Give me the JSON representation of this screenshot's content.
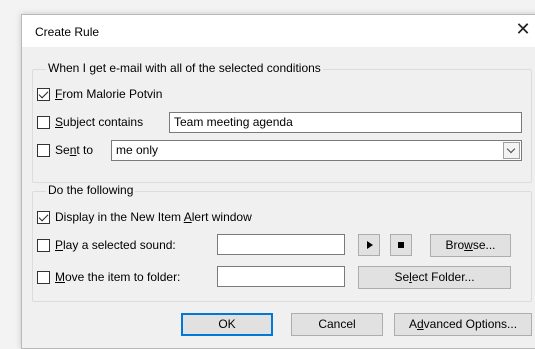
{
  "dialog": {
    "title": "Create Rule",
    "close_glyph": "✕"
  },
  "conditions": {
    "group_label": "When I get e-mail with all of the selected conditions",
    "from": {
      "checked": true,
      "label_u": "F",
      "label_rest": "rom Malorie Potvin"
    },
    "subject": {
      "checked": false,
      "label_u": "S",
      "label_rest": "ubject contains",
      "value": "Team meeting agenda"
    },
    "sent_to": {
      "checked": false,
      "label_pre": "Se",
      "label_u": "n",
      "label_rest": "t to",
      "value": "me only"
    }
  },
  "actions": {
    "group_label": "Do the following",
    "alert": {
      "checked": true,
      "label_pre": "Display in the New Item ",
      "label_u": "A",
      "label_rest": "lert window"
    },
    "sound": {
      "checked": false,
      "label_u": "P",
      "label_rest": "lay a selected sound:",
      "value": "",
      "browse_pre": "Bro",
      "browse_u": "w",
      "browse_rest": "se..."
    },
    "move": {
      "checked": false,
      "label_u": "M",
      "label_rest": "ove the item to folder:",
      "value": "",
      "select_pre": "Se",
      "select_u": "l",
      "select_rest": "ect Folder..."
    }
  },
  "footer": {
    "ok": "OK",
    "cancel": "Cancel",
    "advanced_pre": "A",
    "advanced_u": "d",
    "advanced_rest": "vanced Options..."
  },
  "icons": {
    "close": "close-icon",
    "play": "play-icon",
    "stop": "stop-icon",
    "dropdown": "chevron-down-icon",
    "check": "checkmark-icon"
  }
}
